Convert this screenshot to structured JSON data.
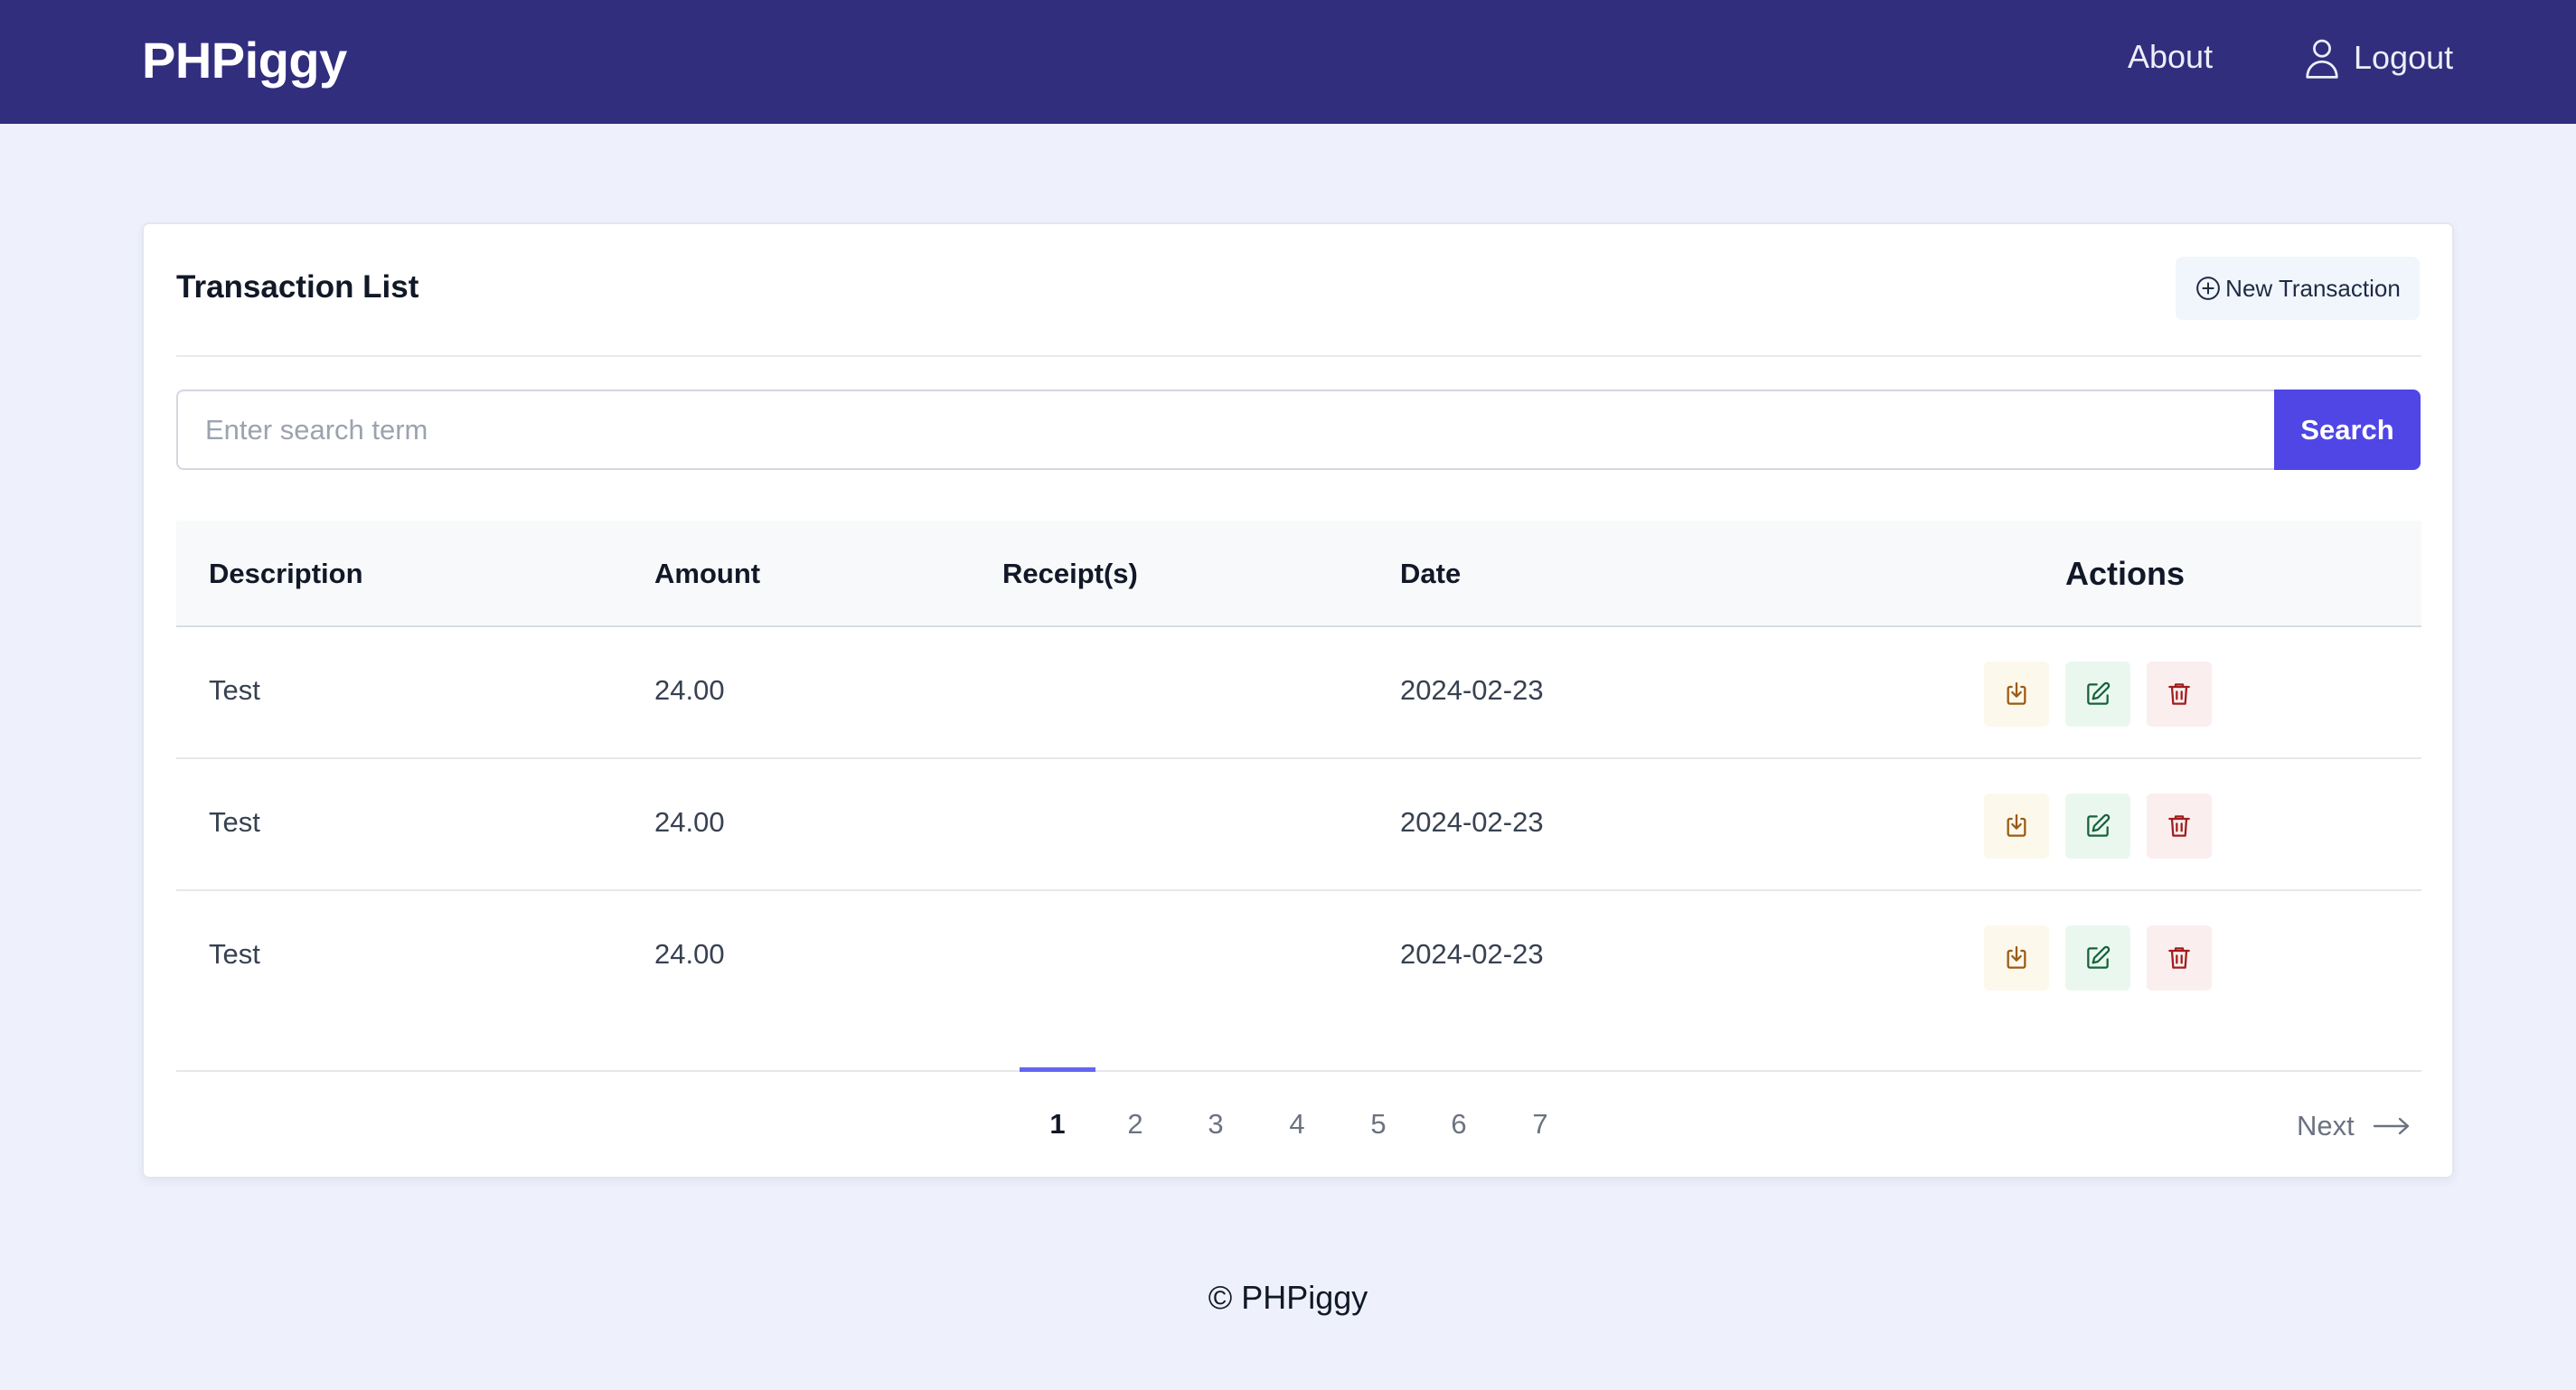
{
  "header": {
    "brand": "PHPiggy",
    "nav": {
      "about": "About",
      "logout": "Logout"
    }
  },
  "card": {
    "title": "Transaction List",
    "new_transaction_label": "New Transaction"
  },
  "search": {
    "placeholder": "Enter search term",
    "value": "",
    "button_label": "Search"
  },
  "table": {
    "columns": [
      "Description",
      "Amount",
      "Receipt(s)",
      "Date",
      "Actions"
    ],
    "rows": [
      {
        "description": "Test",
        "amount": "24.00",
        "receipts": "",
        "date": "2024-02-23"
      },
      {
        "description": "Test",
        "amount": "24.00",
        "receipts": "",
        "date": "2024-02-23"
      },
      {
        "description": "Test",
        "amount": "24.00",
        "receipts": "",
        "date": "2024-02-23"
      }
    ]
  },
  "pagination": {
    "pages": [
      "1",
      "2",
      "3",
      "4",
      "5",
      "6",
      "7"
    ],
    "current": "1",
    "next_label": "Next"
  },
  "footer": {
    "text": "© PHPiggy"
  },
  "colors": {
    "header_bg": "#312e7e",
    "page_bg": "#eef1fc",
    "accent": "#4f46e5",
    "download_bg": "#fdf8ec",
    "edit_bg": "#eaf7ef",
    "delete_bg": "#fbeeee"
  },
  "icons": {
    "logout": "user-icon",
    "new_transaction": "plus-circle-icon",
    "row_actions": [
      "download-icon",
      "edit-icon",
      "trash-icon"
    ],
    "next": "arrow-right-icon"
  }
}
